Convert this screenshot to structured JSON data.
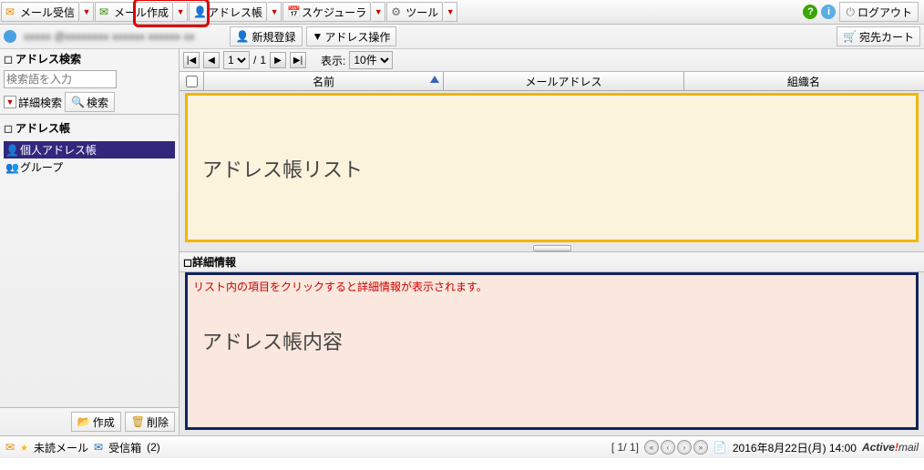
{
  "toolbar": {
    "mail_receive": "メール受信",
    "mail_compose": "メール作成",
    "address_book": "アドレス帳",
    "scheduler": "スケジューラ",
    "tools": "ツール",
    "logout": "ログアウト"
  },
  "subbar": {
    "user": "xxxxx @xxxxxxxx xxxxxx xxxxxx xx",
    "new_register": "新規登録",
    "address_ops_prefix": "▼",
    "address_ops": "アドレス操作",
    "dest_cart": "宛先カート"
  },
  "sidebar": {
    "search_header": "アドレス検索",
    "search_placeholder": "検索語を入力",
    "detail_search": "詳細検索",
    "search_btn": "検索",
    "tree_header": "アドレス帳",
    "items": [
      {
        "label": "個人アドレス帳",
        "icon": "icon-user",
        "selected": true
      },
      {
        "label": "グループ",
        "icon": "icon-group",
        "selected": false
      }
    ],
    "create": "作成",
    "delete": "削除"
  },
  "pager": {
    "page_select": "1",
    "page_total": "1",
    "display_label": "表示:",
    "per_page": "10件"
  },
  "table": {
    "col_name": "名前",
    "col_mail": "メールアドレス",
    "col_org": "組織名"
  },
  "list_overlay": "アドレス帳リスト",
  "detail": {
    "header": "詳細情報",
    "hint": "リスト内の項目をクリックすると詳細情報が表示されます。",
    "overlay": "アドレス帳内容"
  },
  "status": {
    "unread": "未読メール",
    "inbox": "受信箱",
    "inbox_count": "(2)",
    "page": "[ 1/ 1]",
    "datetime": "2016年8月22日(月) 14:00",
    "brand_a": "Active",
    "brand_b": "!",
    "brand_c": "mail"
  }
}
